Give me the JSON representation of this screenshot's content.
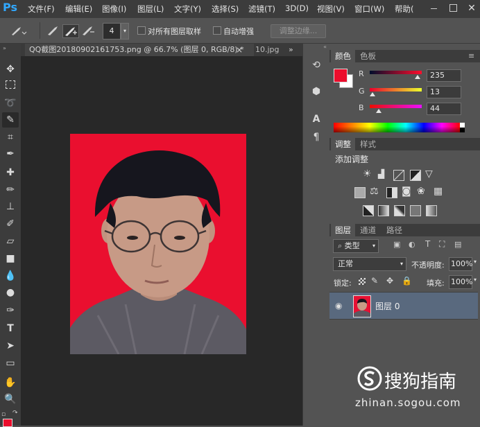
{
  "menubar": {
    "logo": "Ps",
    "items": [
      "文件(F)",
      "编辑(E)",
      "图像(I)",
      "图层(L)",
      "文字(Y)",
      "选择(S)",
      "滤镜(T)",
      "3D(D)",
      "视图(V)",
      "窗口(W)",
      "帮助("
    ],
    "close": "✕"
  },
  "options": {
    "brush_size": "4",
    "sample_all_layers": "对所有图层取样",
    "auto_enhance": "自动增强",
    "refine_edge": "调整边缘..."
  },
  "document": {
    "tab_title": "QQ截图20180902161753.png @ 66.7% (图层 0, RGB/8) *",
    "tab_close": "×",
    "second_tab": "10.jpg",
    "overflow": "»"
  },
  "color_panel": {
    "tabs": [
      "颜色",
      "色板"
    ],
    "channels": [
      {
        "label": "R",
        "value": "235",
        "fraction": 0.92
      },
      {
        "label": "G",
        "value": "13",
        "fraction": 0.05
      },
      {
        "label": "B",
        "value": "44",
        "fraction": 0.17
      }
    ],
    "foreground": "#eb0d2c",
    "background": "#ffffff"
  },
  "adjust_panel": {
    "tabs": [
      "调整",
      "样式"
    ],
    "title": "添加调整"
  },
  "layers_panel": {
    "tabs": [
      "图层",
      "通道",
      "路径"
    ],
    "filter_kind": "类型",
    "blend_mode": "正常",
    "opacity_label": "不透明度:",
    "opacity": "100%",
    "lock_label": "锁定:",
    "fill_label": "填充:",
    "fill": "100%",
    "layer_name": "图层 0"
  },
  "watermark": {
    "brand": "搜狗指南",
    "url": "zhinan.sogou.com"
  }
}
